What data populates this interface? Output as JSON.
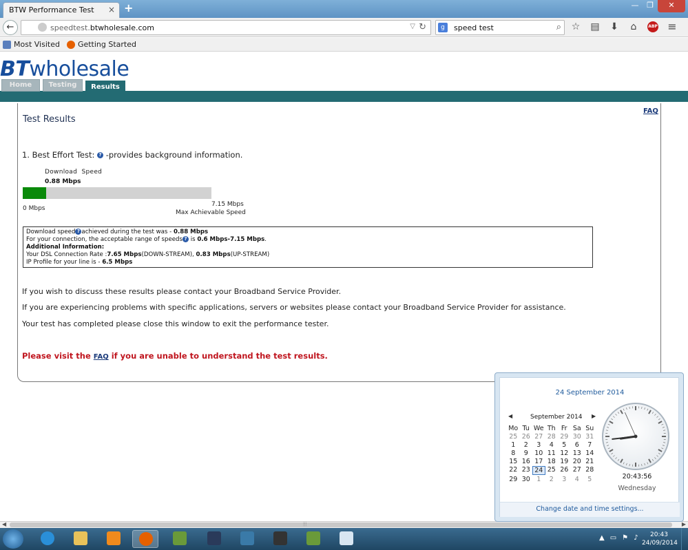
{
  "browser": {
    "tab_title": "BTW Performance Test",
    "tab_close": "×",
    "new_tab": "+",
    "window_controls": {
      "minimize": "—",
      "maximize": "❐",
      "close": "✕"
    },
    "back": "←",
    "url_prefix": "speedtest.",
    "url_domain": "btwholesale.com",
    "search_engine": "g",
    "search_value": "speed test",
    "abp_label": "ABP",
    "bookmarks": [
      {
        "label": "Most Visited"
      },
      {
        "label": "Getting Started"
      }
    ]
  },
  "site": {
    "brand_bt": "BT",
    "brand_rest": "wholesale",
    "nav": {
      "home": "Home",
      "testing": "Testing",
      "results": "Results"
    }
  },
  "results": {
    "faq_top": "FAQ",
    "title": "Test Results",
    "best_effort_prefix": "1. Best Effort Test:",
    "best_effort_suffix": "-provides background information.",
    "download_label": "Download  Speed",
    "download_value": "0.88 Mbps",
    "bar": {
      "value": 0.88,
      "max": 7.15,
      "fill_color": "#0a8a0a"
    },
    "min_label": "0 Mbps",
    "max_value": "7.15 Mbps",
    "max_label": "Max Achievable Speed",
    "info": {
      "line1_a": "Download speed",
      "line1_b": "achieved during the test was - ",
      "line1_val": "0.88 Mbps",
      "line2_a": "For your connection, the acceptable range of speeds",
      "line2_b": " is ",
      "line2_val": "0.6 Mbps-7.15 Mbps",
      "line2_end": ".",
      "line3": "Additional Information:",
      "line4_a": "Your DSL Connection Rate :",
      "line4_down": "7.65 Mbps",
      "line4_down_lbl": "(DOWN-STREAM), ",
      "line4_up": "0.83 Mbps",
      "line4_up_lbl": "(UP-STREAM)",
      "line5_a": "IP Profile for your line is - ",
      "line5_val": "6.5 Mbps"
    },
    "para1": "If you wish to discuss these results please contact your Broadband Service Provider.",
    "para2": "If you are experiencing problems with specific applications, servers or websites please contact your Broadband Service Provider for assistance.",
    "para3": "Your test has completed please close this window to exit the performance tester.",
    "warn_a": "Please visit the ",
    "warn_link": "FAQ",
    "warn_b": " if you are unable to understand the test results."
  },
  "calendar": {
    "date_heading": "24 September 2014",
    "month_label": "September 2014",
    "prev": "◀",
    "next": "▶",
    "dow": [
      "Mo",
      "Tu",
      "We",
      "Th",
      "Fr",
      "Sa",
      "Su"
    ],
    "weeks": [
      [
        [
          "25",
          "o"
        ],
        [
          "26",
          "o"
        ],
        [
          "27",
          "o"
        ],
        [
          "28",
          "o"
        ],
        [
          "29",
          "o"
        ],
        [
          "30",
          "o"
        ],
        [
          "31",
          "o"
        ]
      ],
      [
        [
          "1",
          "d"
        ],
        [
          "2",
          "d"
        ],
        [
          "3",
          "d"
        ],
        [
          "4",
          "d"
        ],
        [
          "5",
          "d"
        ],
        [
          "6",
          "d"
        ],
        [
          "7",
          "d"
        ]
      ],
      [
        [
          "8",
          "d"
        ],
        [
          "9",
          "d"
        ],
        [
          "10",
          "d"
        ],
        [
          "11",
          "d"
        ],
        [
          "12",
          "d"
        ],
        [
          "13",
          "d"
        ],
        [
          "14",
          "d"
        ]
      ],
      [
        [
          "15",
          "d"
        ],
        [
          "16",
          "d"
        ],
        [
          "17",
          "d"
        ],
        [
          "18",
          "d"
        ],
        [
          "19",
          "d"
        ],
        [
          "20",
          "d"
        ],
        [
          "21",
          "d"
        ]
      ],
      [
        [
          "22",
          "d"
        ],
        [
          "23",
          "d"
        ],
        [
          "24",
          "today"
        ],
        [
          "25",
          "d"
        ],
        [
          "26",
          "d"
        ],
        [
          "27",
          "d"
        ],
        [
          "28",
          "d"
        ]
      ],
      [
        [
          "29",
          "d"
        ],
        [
          "30",
          "d"
        ],
        [
          "1",
          "o"
        ],
        [
          "2",
          "o"
        ],
        [
          "3",
          "o"
        ],
        [
          "4",
          "o"
        ],
        [
          "5",
          "o"
        ]
      ]
    ],
    "clock_time": "20:43:56",
    "clock_day": "Wednesday",
    "clock_hands": {
      "hour": 20.73,
      "minute": 43.9,
      "second": 56
    },
    "footer_link": "Change date and time settings..."
  },
  "taskbar": {
    "time": "20:43",
    "date": "24/09/2014",
    "apps": [
      {
        "name": "internet-explorer",
        "color": "#2a8fd8"
      },
      {
        "name": "file-explorer",
        "color": "#e8c25a"
      },
      {
        "name": "media-player",
        "color": "#f08a1c"
      },
      {
        "name": "firefox",
        "color": "#e66000",
        "active": true
      },
      {
        "name": "minecraft",
        "color": "#6a9a3a"
      },
      {
        "name": "star-app",
        "color": "#2a3a5a"
      },
      {
        "name": "game-app",
        "color": "#3a7aa8"
      },
      {
        "name": "eve-online",
        "color": "#333333"
      },
      {
        "name": "minecraft-2",
        "color": "#6a9a3a"
      },
      {
        "name": "window-app",
        "color": "#d8e6f2"
      }
    ]
  }
}
